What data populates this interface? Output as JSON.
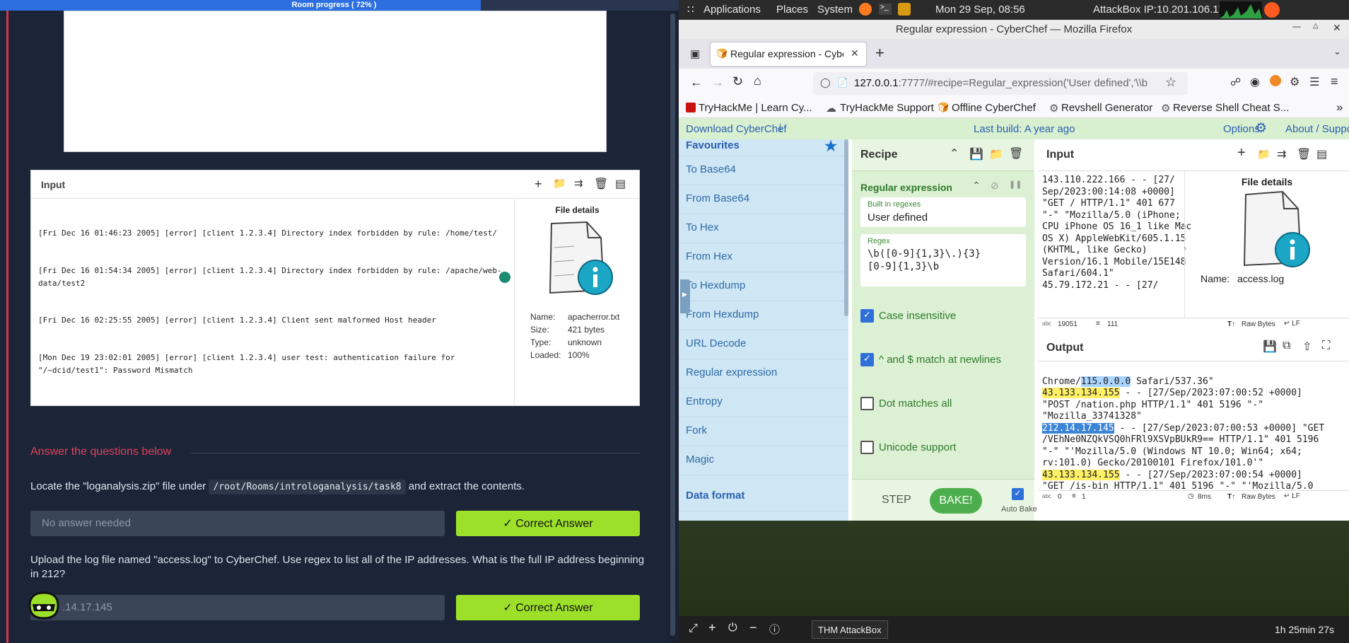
{
  "room": {
    "progress_label": "Room progress ( 72% )",
    "progress": 0.72
  },
  "input_panel": {
    "title": "Input",
    "log_lines": [
      "[Fri Dec 16 01:46:23 2005] [error] [client 1.2.3.4] Directory index forbidden by rule: /home/test/",
      "[Fri Dec 16 01:54:34 2005] [error] [client 1.2.3.4] Directory index forbidden by rule: /apache/web-data/test2",
      "[Fri Dec 16 02:25:55 2005] [error] [client 1.2.3.4] Client sent malformed Host header",
      "[Mon Dec 19 23:02:01 2005] [error] [client 1.2.3.4] user test: authentication failure for \"/~dcid/test1\": Password Mismatch"
    ],
    "file_details": {
      "title": "File details",
      "name_label": "Name:",
      "name": "apacherror.txt",
      "size_label": "Size:",
      "size": "421 bytes",
      "type_label": "Type:",
      "type": "unknown",
      "loaded_label": "Loaded:",
      "loaded": "100%"
    }
  },
  "questions": {
    "heading": "Answer the questions below",
    "q1_text_a": "Locate the \"loganalysis.zip\" file under",
    "q1_code": "/root/Rooms/introloganalysis/task8",
    "q1_text_b": "and extract the contents.",
    "q1_answer": "No answer needed",
    "correct_label": "Correct Answer",
    "q2_text": "Upload the log file named \"access.log\" to CyberChef. Use regex to list all of the IP addresses. What is the full IP address beginning in 212?",
    "q2_answer": ".14.17.145"
  },
  "gnome": {
    "applications": "Applications",
    "places": "Places",
    "system": "System",
    "clock": "Mon 29 Sep, 08:56",
    "attackbox_ip": "AttackBox IP:10.201.106.179"
  },
  "firefox": {
    "window_title": "Regular expression - CyberChef — Mozilla Firefox",
    "tab_title": "Regular expression - Cybe",
    "url_host": "127.0.0.1",
    "url_rest": ":7777/#recipe=Regular_expression('User defined','\\\\b",
    "bookmarks": [
      "TryHackMe | Learn Cy...",
      "TryHackMe Support",
      "Offline CyberChef",
      "Revshell Generator",
      "Reverse Shell Cheat S..."
    ]
  },
  "cyberchef": {
    "download": "Download CyberChef",
    "last_build": "Last build: A year ago",
    "options": "Options",
    "about": "About / Suppo",
    "favourites": "Favourites",
    "operations": [
      "To Base64",
      "From Base64",
      "To Hex",
      "From Hex",
      "To Hexdump",
      "From Hexdump",
      "URL Decode",
      "Regular expression",
      "Entropy",
      "Fork",
      "Magic"
    ],
    "data_format": "Data format",
    "recipe_title": "Recipe",
    "op_name": "Regular expression",
    "builtin_label": "Built in regexes",
    "builtin_value": "User defined",
    "regex_label": "Regex",
    "regex_line1": "\\b([0-9]{1,3}\\.){3}",
    "regex_line2": "[0-9]{1,3}\\b",
    "options_list": [
      {
        "label": "Case insensitive",
        "checked": true
      },
      {
        "label": "^ and $ match at newlines",
        "checked": true
      },
      {
        "label": "Dot matches all",
        "checked": false
      },
      {
        "label": "Unicode support",
        "checked": false
      }
    ],
    "step": "STEP",
    "bake": "BAKE!",
    "auto_bake": "Auto Bake",
    "input_title": "Input",
    "input_text": [
      "143.110.222.166 - - [27/",
      "Sep/2023:00:14:08 +0000]",
      "\"GET / HTTP/1.1\" 401 677",
      "\"-\" \"Mozilla/5.0 (iPhone;",
      "CPU iPhone OS 16_1 like Mac",
      "OS X) AppleWebKit/605.1.15",
      "(KHTML, like Gecko)",
      "Version/16.1 Mobile/15E148",
      "Safari/604.1\"",
      "45.79.172.21 - - [27/"
    ],
    "input_file_details": "File details",
    "input_name_label": "Name:",
    "input_name": "access.log",
    "input_stats_chars": "19051",
    "input_stats_lines": "111",
    "raw_bytes": "Raw Bytes",
    "output_title": "Output",
    "output_stats_chars": "0",
    "output_stats_lines": "1",
    "output_time": "8ms",
    "output": {
      "l1a": "Chrome/",
      "l1b": "115.0.0.0",
      "l1c": " Safari/537.36\"",
      "l2a": "43.133.134.155",
      "l2b": " - - [27/Sep/2023:07:00:52 +0000]",
      "l3": "\"POST /nation.php HTTP/1.1\" 401 5196 \"-\"",
      "l4": "\"Mozilla_33741328\"",
      "l5a": "212.14.17.145",
      "l5b": " - - [27/Sep/2023:07:00:53 +0000] \"GET",
      "l6": "/VEhNe0NZQkVSQ0hFRl9XSVpBUkR9== HTTP/1.1\" 401 5196",
      "l7": "\"-\" \"'Mozilla/5.0 (Windows NT 10.0; Win64; x64;",
      "l8": "rv:101.0) Gecko/20100101 Firefox/101.0'\"",
      "l9a": "43.133.134.155",
      "l9b": " - - [27/Sep/2023:07:00:54 +0000]",
      "l10": "\"GET /is-bin HTTP/1.1\" 401 5196 \"-\" \"'Mozilla/5.0"
    }
  },
  "taskbar": {
    "app": "THM AttackBox",
    "timer": "1h 25min 27s"
  },
  "colors": {
    "accent_green": "#9de02a",
    "brand_red": "#d8334b",
    "progress_blue": "#2d6fe0"
  }
}
